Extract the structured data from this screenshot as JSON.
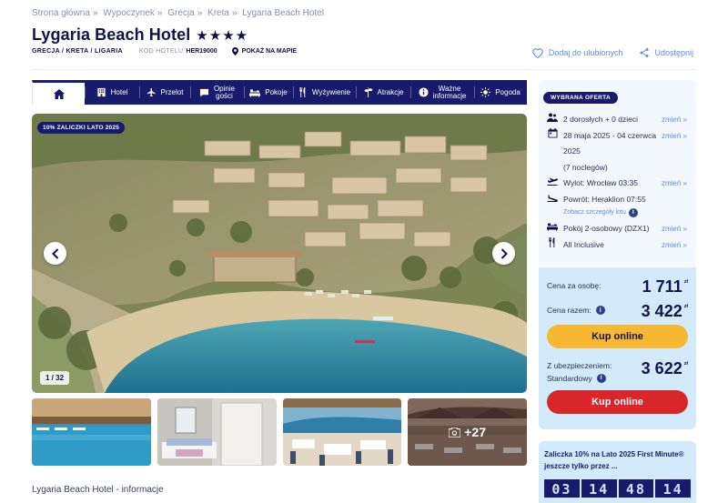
{
  "breadcrumb": [
    "Strona główna",
    "Wypoczynek",
    "Grecja",
    "Kreta",
    "Lygaria Beach Hotel"
  ],
  "breadcrumb_separator": "»",
  "hotel": {
    "name": "Lygaria Beach Hotel",
    "stars": "★★★★",
    "location": "GRECJA / KRETA / LIGARIA",
    "code_label": "KOD HOTELU",
    "code": "HER19000",
    "map_link": "POKAŻ NA MAPIE"
  },
  "actions": {
    "favorite": "Dodaj do ulubionych",
    "share": "Udostępnij"
  },
  "nav": [
    {
      "label": "Hotel",
      "icon": "hotel-icon"
    },
    {
      "label": "Przelot",
      "icon": "plane-icon"
    },
    {
      "label": "Opinie gości",
      "line1": "Opinie",
      "line2": "gości",
      "icon": "chat-icon"
    },
    {
      "label": "Pokoje",
      "icon": "bed-icon"
    },
    {
      "label": "Wyżywienie",
      "icon": "cutlery-icon"
    },
    {
      "label": "Atrakcje",
      "icon": "signpost-icon"
    },
    {
      "label": "Ważne informacje",
      "line1": "Ważne",
      "line2": "informacje",
      "icon": "info-icon"
    },
    {
      "label": "Pogoda",
      "icon": "sun-icon"
    }
  ],
  "gallery": {
    "promo_badge": "10% ZALICZKI LATO 2025",
    "counter": "1 / 32",
    "more_count": "+27"
  },
  "offer": {
    "badge": "WYBRANA OFERTA",
    "change_label": "zmień »",
    "travelers": "2 dorosłych + 0 dzieci",
    "dates_line1": "28 maja 2025 - 04 czerwca",
    "dates_line2": "2025",
    "nights": "(7 noclegów)",
    "departure": "Wylot: Wrocław 03:35",
    "return": "Powrót: Heraklion 07:55",
    "flight_details": "Zobacz szczegóły lotu",
    "room": "Pokój 2-osobowy (DZX1)",
    "board": "All Inclusive"
  },
  "pricing": {
    "per_person_label": "Cena za osobę:",
    "per_person": "1 711",
    "total_label": "Cena razem:",
    "total": "3 422",
    "currency": "zł",
    "buy_label": "Kup online",
    "insured_label_line1": "Z ubezpieczeniem:",
    "insured_label_line2": "Standardowy",
    "insured_total": "3 622"
  },
  "promo": {
    "text": "Zaliczka 10% na Lato 2025 First Minute® jeszcze tylko przez ...",
    "countdown": [
      "03",
      "14",
      "48",
      "14"
    ]
  },
  "info_heading": "Lygaria Beach Hotel - informacje",
  "colors": {
    "navy": "#181a6b",
    "link_blue": "#5a8fd6",
    "price_bg": "#d3eafb",
    "panel_bg": "#f2f8fd",
    "buy_yellow": "#f7b731",
    "buy_red": "#d8262b"
  }
}
